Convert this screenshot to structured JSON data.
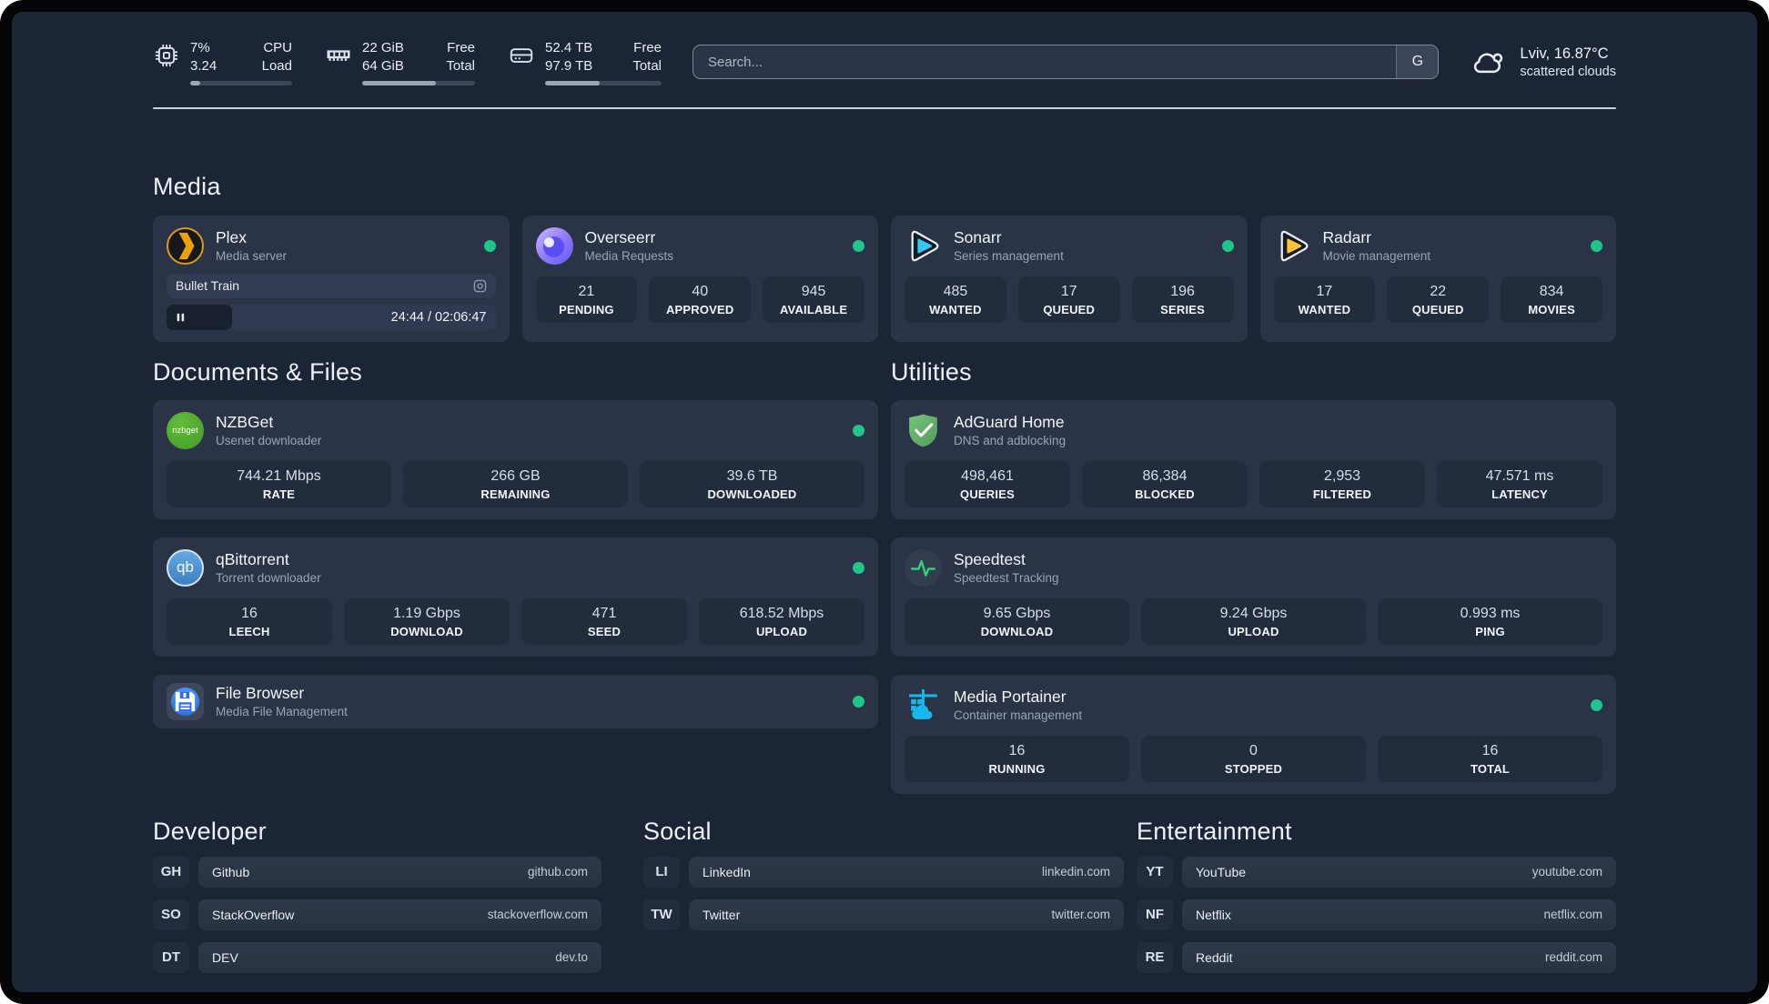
{
  "topbar": {
    "stats": [
      {
        "value1": "7%",
        "value2": "3.24",
        "label1": "CPU",
        "label2": "Load",
        "progress_pct": 10
      },
      {
        "value1": "22 GiB",
        "value2": "64 GiB",
        "label1": "Free",
        "label2": "Total",
        "progress_pct": 65
      },
      {
        "value1": "52.4 TB",
        "value2": "97.9 TB",
        "label1": "Free",
        "label2": "Total",
        "progress_pct": 47
      }
    ],
    "search": {
      "placeholder": "Search...",
      "engine_button": "G"
    },
    "weather": {
      "line1": "Lviv, 16.87°C",
      "line2": "scattered clouds"
    }
  },
  "sections": {
    "media": {
      "title": "Media",
      "apps": [
        {
          "name": "Plex",
          "description": "Media server",
          "online": true,
          "player": {
            "media_title": "Bullet Train",
            "time": "24:44 / 02:06:47",
            "progress_pct": 20
          }
        },
        {
          "name": "Overseerr",
          "description": "Media Requests",
          "online": true,
          "stats": [
            {
              "value": "21",
              "label": "PENDING"
            },
            {
              "value": "40",
              "label": "APPROVED"
            },
            {
              "value": "945",
              "label": "AVAILABLE"
            }
          ]
        },
        {
          "name": "Sonarr",
          "description": "Series management",
          "online": true,
          "stats": [
            {
              "value": "485",
              "label": "WANTED"
            },
            {
              "value": "17",
              "label": "QUEUED"
            },
            {
              "value": "196",
              "label": "SERIES"
            }
          ]
        },
        {
          "name": "Radarr",
          "description": "Movie management",
          "online": true,
          "stats": [
            {
              "value": "17",
              "label": "WANTED"
            },
            {
              "value": "22",
              "label": "QUEUED"
            },
            {
              "value": "834",
              "label": "MOVIES"
            }
          ]
        }
      ]
    },
    "documents": {
      "title": "Documents & Files",
      "apps": [
        {
          "name": "NZBGet",
          "description": "Usenet downloader",
          "online": true,
          "icon_text": "nzbget",
          "stats": [
            {
              "value": "744.21 Mbps",
              "label": "RATE"
            },
            {
              "value": "266 GB",
              "label": "REMAINING"
            },
            {
              "value": "39.6 TB",
              "label": "DOWNLOADED"
            }
          ]
        },
        {
          "name": "qBittorrent",
          "description": "Torrent downloader",
          "online": true,
          "icon_text": "qb",
          "stats": [
            {
              "value": "16",
              "label": "LEECH"
            },
            {
              "value": "1.19 Gbps",
              "label": "DOWNLOAD"
            },
            {
              "value": "471",
              "label": "SEED"
            },
            {
              "value": "618.52 Mbps",
              "label": "UPLOAD"
            }
          ]
        },
        {
          "name": "File Browser",
          "description": "Media File Management",
          "online": true
        }
      ]
    },
    "utilities": {
      "title": "Utilities",
      "apps": [
        {
          "name": "AdGuard Home",
          "description": "DNS and adblocking",
          "stats": [
            {
              "value": "498,461",
              "label": "QUERIES"
            },
            {
              "value": "86,384",
              "label": "BLOCKED"
            },
            {
              "value": "2,953",
              "label": "FILTERED"
            },
            {
              "value": "47.571 ms",
              "label": "LATENCY"
            }
          ]
        },
        {
          "name": "Speedtest",
          "description": "Speedtest Tracking",
          "stats": [
            {
              "value": "9.65 Gbps",
              "label": "DOWNLOAD"
            },
            {
              "value": "9.24 Gbps",
              "label": "UPLOAD"
            },
            {
              "value": "0.993 ms",
              "label": "PING"
            }
          ]
        },
        {
          "name": "Media Portainer",
          "description": "Container management",
          "online": true,
          "stats": [
            {
              "value": "16",
              "label": "RUNNING"
            },
            {
              "value": "0",
              "label": "STOPPED"
            },
            {
              "value": "16",
              "label": "TOTAL"
            }
          ]
        }
      ]
    },
    "developer": {
      "title": "Developer",
      "links": [
        {
          "abbr": "GH",
          "name": "Github",
          "url": "github.com"
        },
        {
          "abbr": "SO",
          "name": "StackOverflow",
          "url": "stackoverflow.com"
        },
        {
          "abbr": "DT",
          "name": "DEV",
          "url": "dev.to"
        }
      ]
    },
    "social": {
      "title": "Social",
      "links": [
        {
          "abbr": "LI",
          "name": "LinkedIn",
          "url": "linkedin.com"
        },
        {
          "abbr": "TW",
          "name": "Twitter",
          "url": "twitter.com"
        }
      ]
    },
    "entertainment": {
      "title": "Entertainment",
      "links": [
        {
          "abbr": "YT",
          "name": "YouTube",
          "url": "youtube.com"
        },
        {
          "abbr": "NF",
          "name": "Netflix",
          "url": "netflix.com"
        },
        {
          "abbr": "RE",
          "name": "Reddit",
          "url": "reddit.com"
        }
      ]
    }
  },
  "colors": {
    "status_online": "#1fc58b",
    "plex_accent": "#e5a00d",
    "sonarr_accent": "#35c5f1",
    "radarr_accent": "#ffc230",
    "adguard_green": "#67b279",
    "portainer_cyan": "#16b8ec",
    "speedtest_pulse": "#2fd07e"
  }
}
